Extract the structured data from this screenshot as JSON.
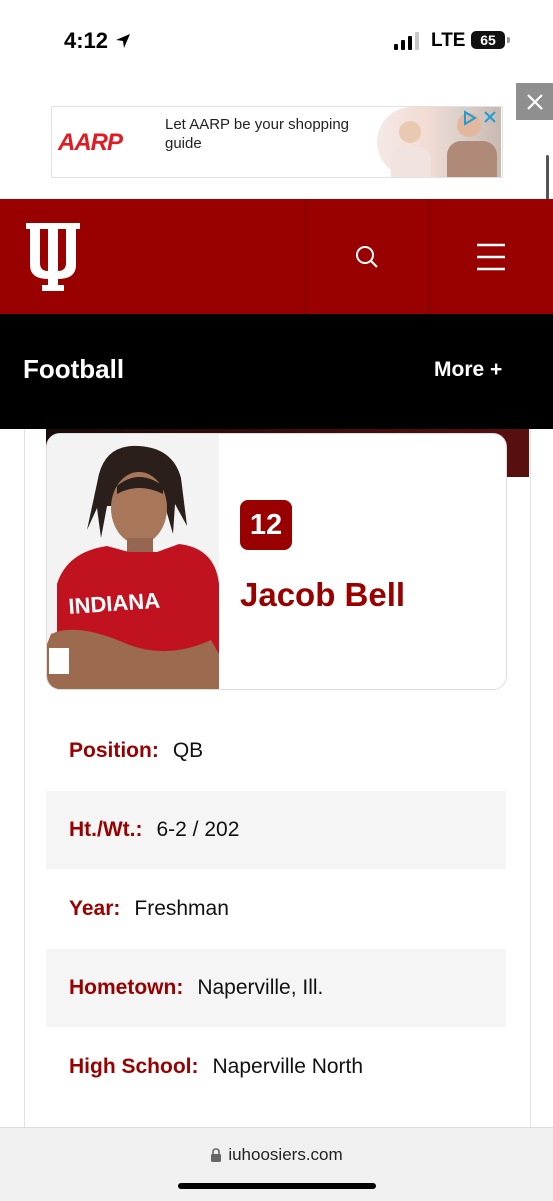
{
  "status_bar": {
    "time": "4:12",
    "network": "LTE",
    "battery": "65"
  },
  "ad": {
    "brand": "AARP",
    "text": "Let AARP be your shopping guide"
  },
  "header": {
    "logo": "IU trident logo",
    "search_icon": "search-icon",
    "menu_icon": "hamburger-menu-icon"
  },
  "sport_bar": {
    "title": "Football",
    "more_label": "More +"
  },
  "player": {
    "number": "12",
    "name": "Jacob Bell",
    "details": [
      {
        "label": "Position:",
        "value": "QB"
      },
      {
        "label": "Ht./Wt.:",
        "value": "6-2 / 202"
      },
      {
        "label": "Year:",
        "value": "Freshman"
      },
      {
        "label": "Hometown:",
        "value": "Naperville, Ill."
      },
      {
        "label": "High School:",
        "value": "Naperville North"
      }
    ]
  },
  "browser": {
    "url": "iuhoosiers.com"
  },
  "colors": {
    "brand": "#990000",
    "sport_bar": "#000000"
  }
}
